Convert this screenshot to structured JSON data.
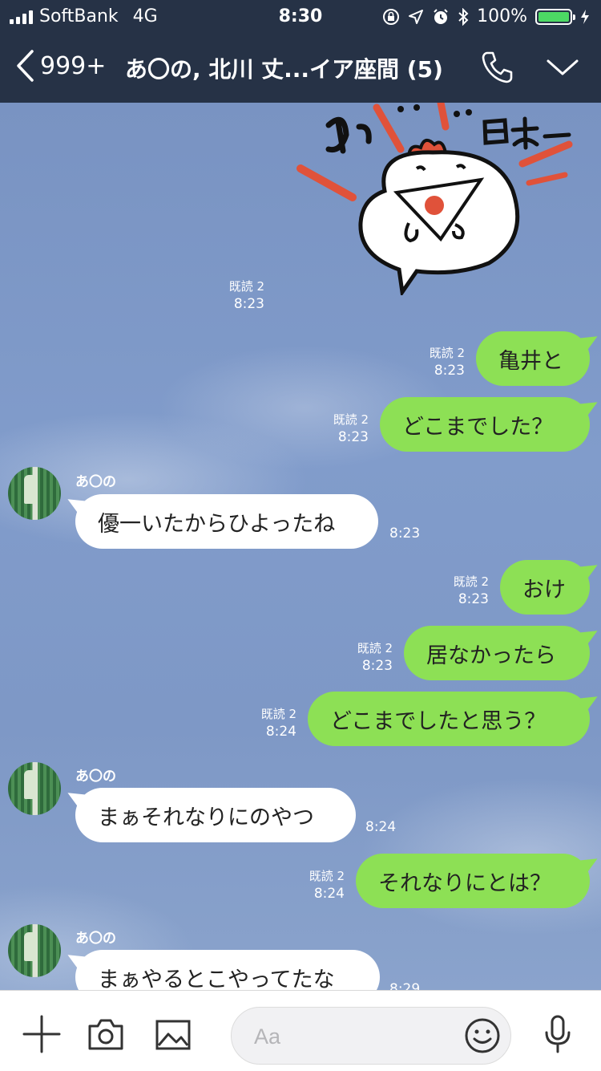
{
  "status_bar": {
    "carrier": "SoftBank",
    "network": "4G",
    "time": "8:30",
    "battery_text": "100%",
    "battery_level": 1.0
  },
  "header": {
    "unread_count": "999+",
    "title": "あ〇の, 北川 丈...イア座間 (5)"
  },
  "colors": {
    "header_bg": "#263246",
    "my_bubble": "#8de055",
    "their_bubble": "#ffffff",
    "chat_bg": "#7f9ac6"
  },
  "sticker": {
    "text": "よっ日本一",
    "read": "既読 2",
    "time": "8:23"
  },
  "messages": [
    {
      "from": "me",
      "text": "亀井と",
      "read": "既読 2",
      "time": "8:23"
    },
    {
      "from": "me",
      "text": "どこまでした？",
      "read": "既読 2",
      "time": "8:23"
    },
    {
      "from": "them",
      "sender": "あ〇の",
      "text": "優一いたからひよったね",
      "time": "8:23"
    },
    {
      "from": "me",
      "text": "おけ",
      "read": "既読 2",
      "time": "8:23"
    },
    {
      "from": "me",
      "text": "居なかったら",
      "read": "既読 2",
      "time": "8:23"
    },
    {
      "from": "me",
      "text": "どこまでしたと思う？",
      "read": "既読 2",
      "time": "8:24"
    },
    {
      "from": "them",
      "sender": "あ〇の",
      "text": "まぁそれなりにのやつ",
      "time": "8:24"
    },
    {
      "from": "me",
      "text": "それなりにとは？",
      "read": "既読 2",
      "time": "8:24"
    },
    {
      "from": "them",
      "sender": "あ〇の",
      "text": "まぁやるとこやってたな",
      "time": "8:29"
    }
  ],
  "input": {
    "placeholder": "Aa"
  },
  "icons": {
    "back": "chevron-left-icon",
    "call": "phone-icon",
    "menu": "chevron-down-icon",
    "add": "plus-icon",
    "camera": "camera-icon",
    "image": "image-icon",
    "emoji": "smiley-icon",
    "mic": "microphone-icon"
  }
}
